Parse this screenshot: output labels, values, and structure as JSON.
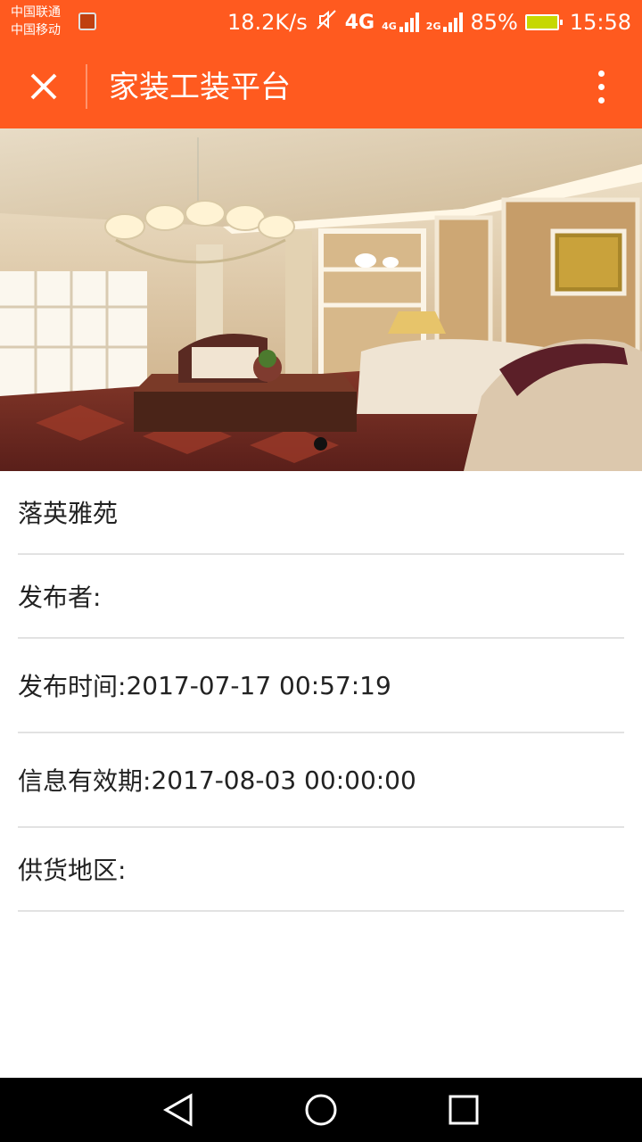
{
  "status_bar": {
    "carrier_1": "中国联通",
    "carrier_2": "中国移动",
    "net_speed": "18.2K/s",
    "net_4g_a": "4G",
    "net_4g_b": "4G",
    "net_2g": "2G",
    "battery": "85%",
    "time": "15:58",
    "icons": [
      "image-icon",
      "mute-icon",
      "signal-icon",
      "battery-icon"
    ]
  },
  "header": {
    "title": "家装工装平台",
    "close_icon": "close-icon",
    "more_icon": "more-vertical-icon",
    "color": "#ff5a1f"
  },
  "banner": {
    "slide_count": 1,
    "active_index": 0
  },
  "info": {
    "name": "落英雅苑",
    "publisher_label": "发布者:",
    "publisher_value": "",
    "publish_time_label": "发布时间:",
    "publish_time_value": "2017-07-17 00:57:19",
    "validity_label": "信息有效期:",
    "validity_value": "2017-08-03 00:00:00",
    "region_label": "供货地区:",
    "region_value": ""
  },
  "nav": {
    "back_icon": "back-triangle-icon",
    "home_icon": "home-circle-icon",
    "recents_icon": "recents-square-icon"
  }
}
